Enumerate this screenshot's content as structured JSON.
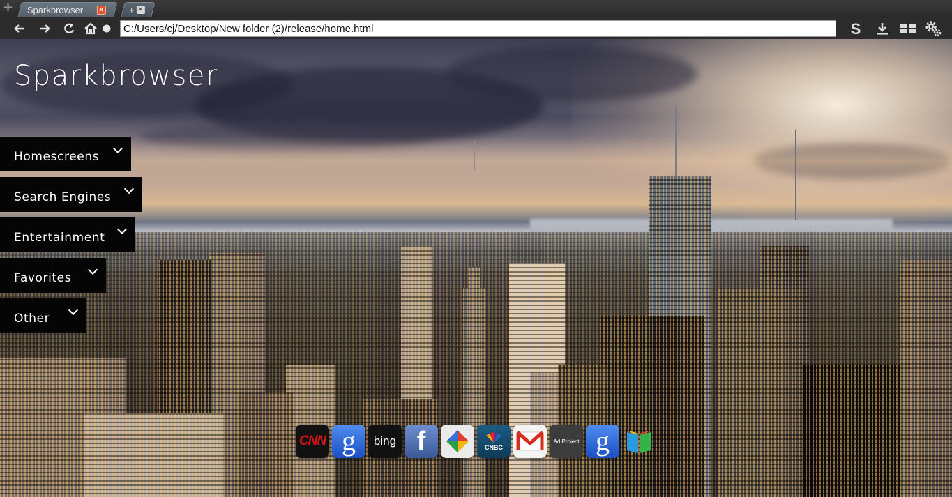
{
  "browser": {
    "tabs": [
      {
        "title": "Sparkbrowser",
        "active": true,
        "close_glyph": "×"
      }
    ],
    "new_tab_glyph": "+",
    "new_tab_close_glyph": "×",
    "toolbar": {
      "back_icon": "back-arrow-icon",
      "forward_icon": "forward-arrow-icon",
      "reload_icon": "reload-icon",
      "home_icon": "home-icon",
      "address": "C:/Users/cj/Desktop/New folder (2)/release/home.html",
      "right_icons": [
        "spark-s-icon",
        "download-icon",
        "grid-view-icon",
        "settings-gear-icon"
      ]
    }
  },
  "page": {
    "title": "Sparkbrowser",
    "background": "new-york-city-skyline-sunset-photo",
    "menu": [
      {
        "label": "Homescreens"
      },
      {
        "label": "Search Engines"
      },
      {
        "label": "Entertainment"
      },
      {
        "label": "Favorites"
      },
      {
        "label": "Other"
      }
    ],
    "dock": [
      {
        "name": "cnn",
        "text": "CNN"
      },
      {
        "name": "google",
        "text": "g"
      },
      {
        "name": "bing",
        "text": "bing"
      },
      {
        "name": "facebook",
        "text": "f"
      },
      {
        "name": "picasa",
        "text": ""
      },
      {
        "name": "cnbc",
        "text": "CNBC"
      },
      {
        "name": "gmail",
        "text": ""
      },
      {
        "name": "aol-project",
        "text": "Ad Project"
      },
      {
        "name": "google-2",
        "text": "g"
      },
      {
        "name": "google-books",
        "text": ""
      }
    ]
  },
  "colors": {
    "tab_close": "#e2542a",
    "menu_bg": "#050505",
    "toolbar_bg": "#2c2c2c"
  }
}
